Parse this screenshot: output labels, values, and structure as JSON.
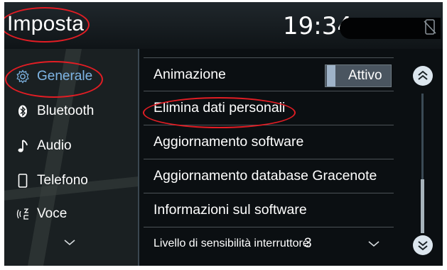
{
  "header": {
    "title": "Imposta",
    "time": "19:34"
  },
  "sidebar": {
    "items": [
      {
        "label": "Generale",
        "icon": "gear-icon",
        "selected": true
      },
      {
        "label": "Bluetooth",
        "icon": "bluetooth-icon",
        "selected": false
      },
      {
        "label": "Audio",
        "icon": "music-note-icon",
        "selected": false
      },
      {
        "label": "Telefono",
        "icon": "phone-icon",
        "selected": false
      },
      {
        "label": "Voce",
        "icon": "voice-icon",
        "selected": false
      }
    ]
  },
  "settings": {
    "rows": [
      {
        "label": "Animazione"
      },
      {
        "label": "Elimina dati personali"
      },
      {
        "label": "Aggiornamento software"
      },
      {
        "label": "Aggiornamento database Gracenote"
      },
      {
        "label": "Informazioni sul software"
      },
      {
        "label": "Livello di sensibilità interruttore"
      }
    ],
    "animation_toggle": "Attivo",
    "sensitivity_value": "3"
  },
  "colors": {
    "accent_blue": "#7fb6e6",
    "annotation_red": "#e21d24"
  },
  "scroll": {
    "position_fraction": 0.6
  }
}
